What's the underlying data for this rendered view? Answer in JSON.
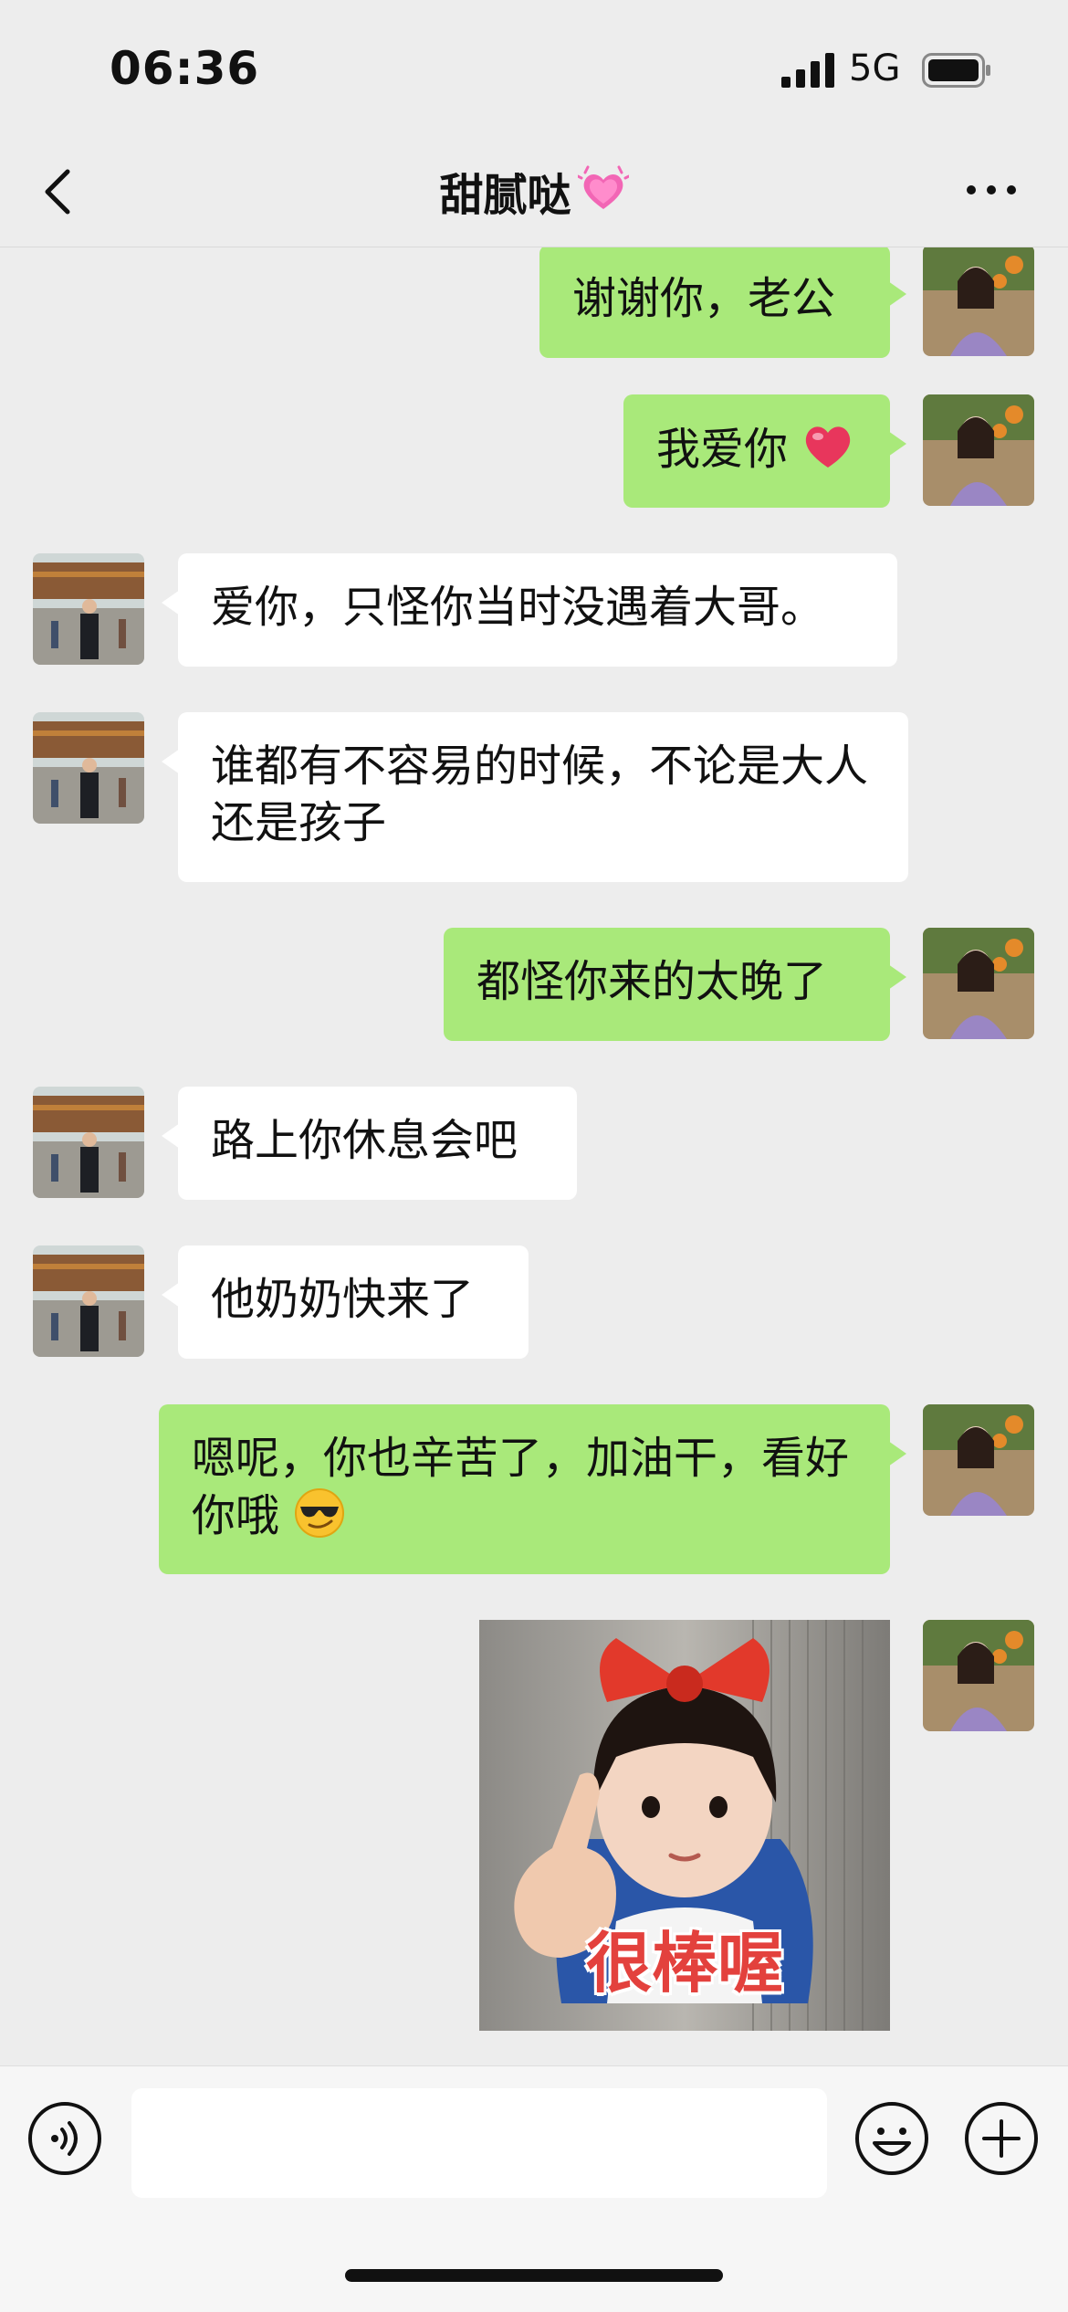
{
  "status_bar": {
    "time": "06:36",
    "network": "5G",
    "icons": [
      "signal-icon",
      "battery-icon"
    ]
  },
  "nav": {
    "title": "甜腻哒",
    "title_emoji": "sparkling-heart-icon",
    "back_icon": "chevron-left-icon",
    "more_icon": "more-dots-icon"
  },
  "messages": [
    {
      "side": "me",
      "text": "谢谢你，老公"
    },
    {
      "side": "me",
      "text": "我爱你",
      "emoji": "red-heart-icon"
    },
    {
      "side": "other",
      "text": "爱你，只怪你当时没遇着大哥。"
    },
    {
      "side": "other",
      "text": "谁都有不容易的时候，不论是大人还是孩子"
    },
    {
      "side": "me",
      "text": "都怪你来的太晚了"
    },
    {
      "side": "other",
      "text": "路上你休息会吧"
    },
    {
      "side": "other",
      "text": "他奶奶快来了"
    },
    {
      "side": "me",
      "text": "嗯呢，你也辛苦了，加油干，看好你哦",
      "emoji": "sunglasses-face-icon"
    },
    {
      "side": "me",
      "type": "sticker",
      "caption": "很棒喔"
    }
  ],
  "input_bar": {
    "input_value": "",
    "icons": [
      "voice-icon",
      "emoji-icon",
      "plus-icon"
    ]
  },
  "colors": {
    "my_bubble": "#a9e97a",
    "their_bubble": "#ffffff",
    "background": "#ededed"
  }
}
